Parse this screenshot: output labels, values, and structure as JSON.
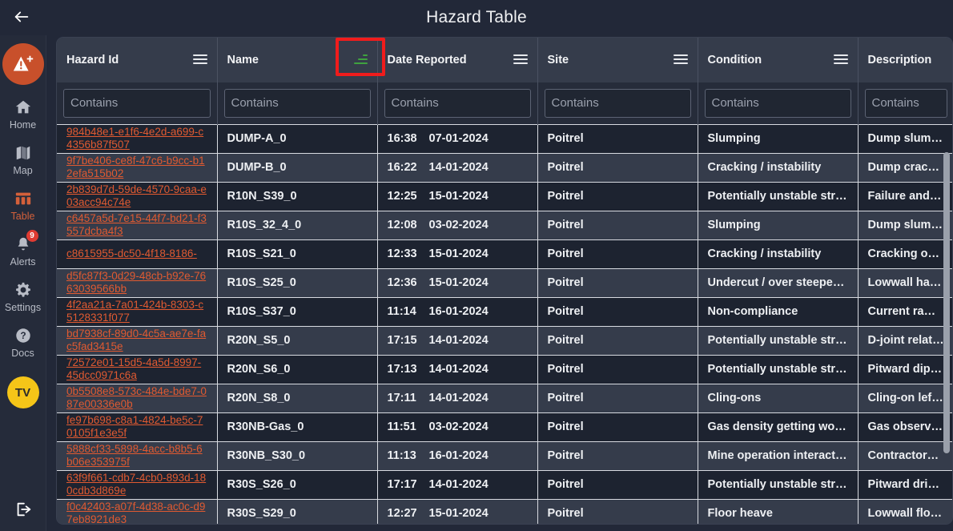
{
  "header": {
    "title": "Hazard Table",
    "back_icon": "arrow-left-icon"
  },
  "sidebar": {
    "logo": {
      "icon": "hazard-add-icon",
      "color": "#c8502b"
    },
    "items": [
      {
        "label": "Home",
        "icon": "home-icon",
        "active": false
      },
      {
        "label": "Map",
        "icon": "map-icon",
        "active": false
      },
      {
        "label": "Table",
        "icon": "table-icon",
        "active": true
      },
      {
        "label": "Alerts",
        "icon": "bell-icon",
        "active": false,
        "badge": "9"
      },
      {
        "label": "Settings",
        "icon": "gear-icon",
        "active": false
      },
      {
        "label": "Docs",
        "icon": "question-icon",
        "active": false
      }
    ],
    "avatar": {
      "initials": "TV",
      "color": "#f5c518"
    },
    "logout": {
      "icon": "logout-icon"
    }
  },
  "table": {
    "columns": [
      {
        "label": "Hazard Id",
        "icon": "hamburger-menu-icon",
        "filter_active": false
      },
      {
        "label": "Name",
        "icon": "filter-icon",
        "filter_active": true
      },
      {
        "label": "Date Reported",
        "icon": "hamburger-menu-icon",
        "filter_active": false
      },
      {
        "label": "Site",
        "icon": "hamburger-menu-icon",
        "filter_active": false
      },
      {
        "label": "Condition",
        "icon": "hamburger-menu-icon",
        "filter_active": false
      },
      {
        "label": "Description",
        "icon": "hamburger-menu-icon",
        "filter_active": false
      }
    ],
    "filter_placeholder": "Contains",
    "filter_values": [
      "",
      "",
      "",
      "",
      "",
      ""
    ],
    "rows": [
      {
        "hazard_id": "984b48e1-e1f6-4e2d-a699-c4356b87f507",
        "name": "DUMP-A_0",
        "time": "16:38",
        "date": "07-01-2024",
        "site": "Poitrel",
        "condition": "Slumping",
        "description": "Dump slumping"
      },
      {
        "hazard_id": "9f7be406-ce8f-47c6-b9cc-b12efa515b02",
        "name": "DUMP-B_0",
        "time": "16:22",
        "date": "14-01-2024",
        "site": "Poitrel",
        "condition": "Cracking / instability",
        "description": "Dump cracking"
      },
      {
        "hazard_id": "2b839d7d-59de-4570-9caa-e03acc94c74e",
        "name": "R10N_S39_0",
        "time": "12:25",
        "date": "15-01-2024",
        "site": "Poitrel",
        "condition": "Potentially unstable structu...",
        "description": "Failure and cra"
      },
      {
        "hazard_id": "c6457a5d-7e15-44f7-bd21-f3557dcba4f3",
        "name": "R10S_32_4_0",
        "time": "12:08",
        "date": "03-02-2024",
        "site": "Poitrel",
        "condition": "Slumping",
        "description": "Dump slumped"
      },
      {
        "hazard_id": "c8615955-dc50-4f18-8186-",
        "name": "R10S_S21_0",
        "time": "12:33",
        "date": "15-01-2024",
        "site": "Poitrel",
        "condition": "Cracking / instability",
        "description": "Cracking obser"
      },
      {
        "hazard_id": "d5fc87f3-0d29-48cb-b92e-7663039566bb",
        "name": "R10S_S25_0",
        "time": "12:36",
        "date": "15-01-2024",
        "site": "Poitrel",
        "condition": "Undercut / over steepened",
        "description": "Lowwall has be"
      },
      {
        "hazard_id": "4f2aa21a-7a01-424b-8303-c5128331f077",
        "name": "R10S_S37_0",
        "time": "11:14",
        "date": "16-01-2024",
        "site": "Poitrel",
        "condition": "Non-compliance",
        "description": "Current ramp r"
      },
      {
        "hazard_id": "bd7938cf-89d0-4c5a-ae7e-fac5fad3415e",
        "name": "R20N_S5_0",
        "time": "17:15",
        "date": "14-01-2024",
        "site": "Poitrel",
        "condition": "Potentially unstable structu...",
        "description": "D-joint related"
      },
      {
        "hazard_id": "72572e01-15d5-4a5d-8997-45dcc0971c6a",
        "name": "R20N_S6_0",
        "time": "17:13",
        "date": "14-01-2024",
        "site": "Poitrel",
        "condition": "Potentially unstable structu...",
        "description": "Pitward dipping"
      },
      {
        "hazard_id": "0b5508e8-573c-484e-bde7-087e00336e0b",
        "name": "R20N_S8_0",
        "time": "17:11",
        "date": "14-01-2024",
        "site": "Poitrel",
        "condition": "Cling-ons",
        "description": "Cling-on left po"
      },
      {
        "hazard_id": "fe97b698-c8a1-4824-be5c-70105f1e3e5f",
        "name": "R30NB-Gas_0",
        "time": "11:51",
        "date": "03-02-2024",
        "site": "Poitrel",
        "condition": "Gas density getting worse",
        "description": "Gas observed a"
      },
      {
        "hazard_id": "5888cf33-5898-4acc-b8b5-6b06e353975f",
        "name": "R30NB_S30_0",
        "time": "11:13",
        "date": "16-01-2024",
        "site": "Poitrel",
        "condition": "Mine operation interactions",
        "description": "Contractors di"
      },
      {
        "hazard_id": "63f9f661-cdb7-4cb0-893d-180cdb3d869e",
        "name": "R30S_S26_0",
        "time": "17:17",
        "date": "14-01-2024",
        "site": "Poitrel",
        "condition": "Potentially unstable structu...",
        "description": "Pitward dripping"
      },
      {
        "hazard_id": "f0c42403-a07f-4d38-ac0c-d97eb8921de3",
        "name": "R30S_S29_0",
        "time": "12:27",
        "date": "15-01-2024",
        "site": "Poitrel",
        "condition": "Floor heave",
        "description": "Lowwall floor h"
      }
    ]
  },
  "annotation": {
    "target": "name-column-filter-icon",
    "color": "#f01c1c"
  },
  "colors": {
    "accent": "#d4603a",
    "link": "#e05a31",
    "filter_active": "#3fa23f",
    "badge": "#e03b32",
    "avatar": "#f5c518",
    "page_bg": "#222838",
    "header_bg": "#353c4b",
    "row_odd": "#1d2330",
    "row_even": "#353c4b"
  }
}
